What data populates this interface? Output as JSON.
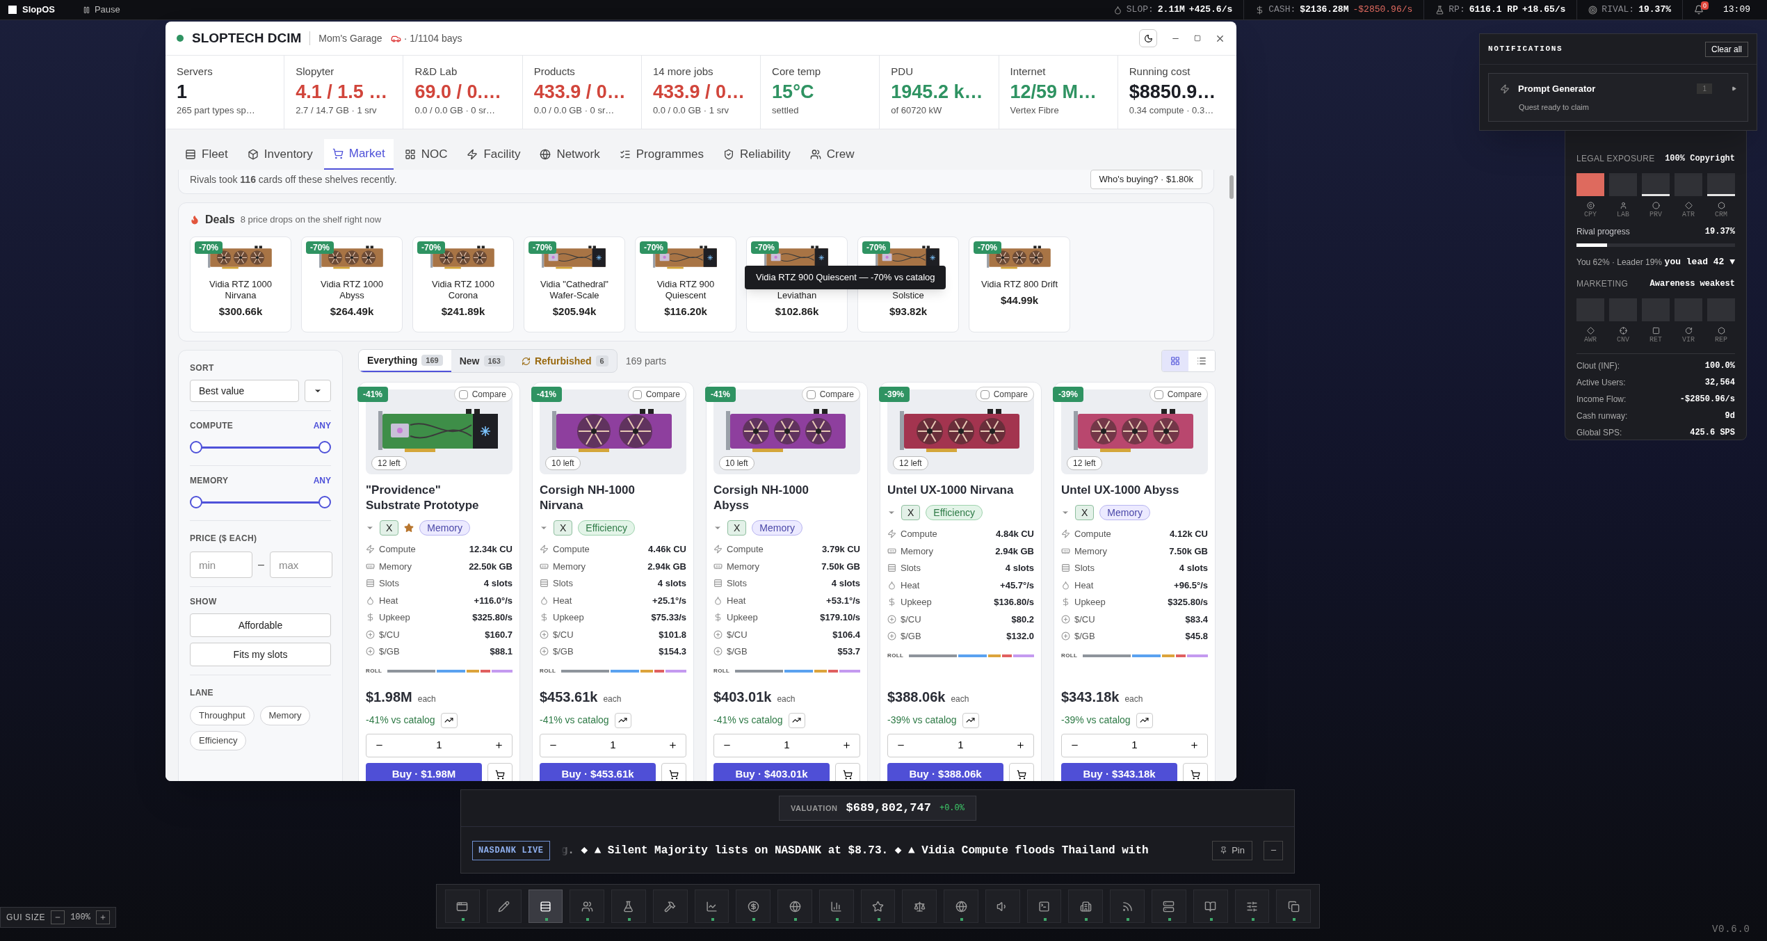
{
  "top_bar": {
    "brand": "SlopOS",
    "pause": "Pause",
    "stats": [
      {
        "label": "SLOP:",
        "value": "2.11M",
        "delta": "+425.6/s",
        "kind": "up"
      },
      {
        "label": "CASH:",
        "value": "$2136.28M",
        "delta": "-$2850.96/s",
        "kind": "down"
      },
      {
        "label": "RP:",
        "value": "6116.1 RP",
        "delta": "+18.65/s",
        "kind": "up"
      },
      {
        "label": "RIVAL:",
        "value": "19.37%"
      }
    ],
    "badge": "0",
    "time": "13:09"
  },
  "window": {
    "title": "SLOPTECH DCIM",
    "location": "Mom's Garage",
    "bays": "· 1/1104 bays",
    "stats": [
      {
        "label": "Servers",
        "value": "1",
        "sub": "265 part types sp…",
        "kind": "plain"
      },
      {
        "label": "Slopyter",
        "value": "4.1 / 1.5 …",
        "sub": "2.7 / 14.7 GB · 1 srv",
        "kind": "bad"
      },
      {
        "label": "R&D Lab",
        "value": "69.0 / 0.…",
        "sub": "0.0 / 0.0 GB · 0 sr…",
        "kind": "bad"
      },
      {
        "label": "Products",
        "value": "433.9 / 0…",
        "sub": "0.0 / 0.0 GB · 0 sr…",
        "kind": "bad"
      },
      {
        "label": "14 more jobs",
        "value": "433.9 / 0…",
        "sub": "0.0 / 0.0 GB · 1 srv",
        "kind": "bad"
      },
      {
        "label": "Core temp",
        "value": "15°C",
        "sub": "settled",
        "kind": "good"
      },
      {
        "label": "PDU",
        "value": "1945.2 k…",
        "sub": "of 60720 kW",
        "kind": "good"
      },
      {
        "label": "Internet",
        "value": "12/59 M…",
        "sub": "Vertex Fibre",
        "kind": "good"
      },
      {
        "label": "Running cost",
        "value": "$8850.9…",
        "sub": "0.34 compute · 0.3…",
        "kind": "plain"
      }
    ],
    "tabs": [
      {
        "label": "Fleet",
        "selected": false
      },
      {
        "label": "Inventory",
        "selected": false
      },
      {
        "label": "Market",
        "selected": true
      },
      {
        "label": "NOC",
        "selected": false
      },
      {
        "label": "Facility",
        "selected": false
      },
      {
        "label": "Network",
        "selected": false
      },
      {
        "label": "Programmes",
        "selected": false
      },
      {
        "label": "Reliability",
        "selected": false
      },
      {
        "label": "Crew",
        "selected": false
      }
    ]
  },
  "market": {
    "rivals_note": "Rivals took **116** cards off these shelves recently.",
    "whos_buying": "Who's buying? · $1.80k",
    "deals": {
      "title": "Deals",
      "subtitle": "8 price drops on the shelf right now",
      "tooltip": "Vidia RTZ 900 Quiescent — -70% vs catalog",
      "items": [
        {
          "badge": "-70%",
          "name": "Vidia RTZ 1000\nNirvana",
          "price": "$300.66k",
          "kind": "fans"
        },
        {
          "badge": "-70%",
          "name": "Vidia RTZ 1000\nAbyss",
          "price": "$264.49k",
          "kind": "fans"
        },
        {
          "badge": "-70%",
          "name": "Vidia RTZ 1000\nCorona",
          "price": "$241.89k",
          "kind": "fans"
        },
        {
          "badge": "-70%",
          "name": "Vidia \"Cathedral\"\nWafer-Scale",
          "price": "$205.94k",
          "kind": "blower"
        },
        {
          "badge": "-70%",
          "name": "Vidia RTZ 900\nQuiescent",
          "price": "$116.20k",
          "kind": "blower"
        },
        {
          "badge": "-70%",
          "name": "\nLeviathan",
          "price": "$102.86k",
          "kind": "blower"
        },
        {
          "badge": "-70%",
          "name": "\nSolstice",
          "price": "$93.82k",
          "kind": "blower"
        },
        {
          "badge": "-70%",
          "name": "Vidia RTZ 800 Drift",
          "price": "$44.99k",
          "kind": "fans"
        }
      ]
    },
    "filters": {
      "sort_label": "SORT",
      "sort_value": "Best value",
      "ranges": [
        {
          "label": "COMPUTE",
          "reading": "ANY",
          "level": 1
        },
        {
          "label": "MEMORY",
          "reading": "ANY",
          "level": 1
        }
      ],
      "price_label": "PRICE ($ EACH)",
      "min_placeholder": "min",
      "separator": "–",
      "max_placeholder": "max",
      "show_label": "SHOW",
      "show_buttons": [
        "Affordable",
        "Fits my slots"
      ],
      "lane_label": "LANE",
      "lanes": [
        "Throughput",
        "Memory",
        "Efficiency"
      ]
    },
    "segments": [
      {
        "label": "Everything",
        "count": "169",
        "kind": "all",
        "selected": true
      },
      {
        "label": "New",
        "count": "163",
        "kind": "new",
        "selected": false
      },
      {
        "label": "Refurbished",
        "count": "6",
        "kind": "refurbished",
        "selected": false
      }
    ],
    "parts_count": "169 parts",
    "views": [
      {
        "kind": "grid",
        "selected": true
      },
      {
        "kind": "list",
        "selected": false
      }
    ],
    "products": [
      {
        "discount": "-41%",
        "compare": {
          "label": "Compare",
          "checked": false
        },
        "stock": "12 left",
        "kind": "blower",
        "name": "\"Providence\"\nSubstrate Prototype",
        "tags": [
          {
            "kind": "tier",
            "label": "X"
          },
          {
            "kind": "star"
          },
          {
            "kind": "memory",
            "label": "Memory"
          }
        ],
        "specs": [
          {
            "label": "Compute",
            "value": "12.34k CU"
          },
          {
            "label": "Memory",
            "value": "22.50k GB"
          },
          {
            "label": "Slots",
            "value": "4 slots"
          },
          {
            "label": "Heat",
            "value": "+116.0°/s"
          },
          {
            "label": "Upkeep",
            "value": "$325.80/s"
          },
          {
            "label": "$/CU",
            "value": "$160.7"
          },
          {
            "label": "$/GB",
            "value": "$88.1"
          }
        ],
        "roll": "ROLL",
        "price": "$1.98M",
        "unit": "each",
        "vs_catalog": "-41% vs catalog",
        "qty": "1",
        "buy": "Buy · $1.98M"
      },
      {
        "discount": "-41%",
        "compare": {
          "label": "Compare",
          "checked": false
        },
        "stock": "10 left",
        "kind": "two-fan",
        "name": "Corsigh NH-1000\nNirvana",
        "tags": [
          {
            "kind": "tier",
            "label": "X"
          },
          {
            "kind": "efficiency",
            "label": "Efficiency"
          }
        ],
        "specs": [
          {
            "label": "Compute",
            "value": "4.46k CU"
          },
          {
            "label": "Memory",
            "value": "2.94k GB"
          },
          {
            "label": "Slots",
            "value": "4 slots"
          },
          {
            "label": "Heat",
            "value": "+25.1°/s"
          },
          {
            "label": "Upkeep",
            "value": "$75.33/s"
          },
          {
            "label": "$/CU",
            "value": "$101.8"
          },
          {
            "label": "$/GB",
            "value": "$154.3"
          }
        ],
        "roll": "ROLL",
        "price": "$453.61k",
        "unit": "each",
        "vs_catalog": "-41% vs catalog",
        "qty": "1",
        "buy": "Buy · $453.61k"
      },
      {
        "discount": "-41%",
        "compare": {
          "label": "Compare",
          "checked": false
        },
        "stock": "10 left",
        "kind": "fans",
        "name": "Corsigh NH-1000\nAbyss",
        "tags": [
          {
            "kind": "tier",
            "label": "X"
          },
          {
            "kind": "memory",
            "label": "Memory"
          }
        ],
        "specs": [
          {
            "label": "Compute",
            "value": "3.79k CU"
          },
          {
            "label": "Memory",
            "value": "7.50k GB"
          },
          {
            "label": "Slots",
            "value": "4 slots"
          },
          {
            "label": "Heat",
            "value": "+53.1°/s"
          },
          {
            "label": "Upkeep",
            "value": "$179.10/s"
          },
          {
            "label": "$/CU",
            "value": "$106.4"
          },
          {
            "label": "$/GB",
            "value": "$53.7"
          }
        ],
        "roll": "ROLL",
        "price": "$403.01k",
        "unit": "each",
        "vs_catalog": "-41% vs catalog",
        "qty": "1",
        "buy": "Buy · $403.01k"
      },
      {
        "discount": "-39%",
        "compare": {
          "label": "Compare",
          "checked": false
        },
        "stock": "12 left",
        "kind": "fans",
        "name": "Untel UX-1000 Nirvana",
        "tags": [
          {
            "kind": "tier",
            "label": "X"
          },
          {
            "kind": "efficiency",
            "label": "Efficiency"
          }
        ],
        "specs": [
          {
            "label": "Compute",
            "value": "4.84k CU"
          },
          {
            "label": "Memory",
            "value": "2.94k GB"
          },
          {
            "label": "Slots",
            "value": "4 slots"
          },
          {
            "label": "Heat",
            "value": "+45.7°/s"
          },
          {
            "label": "Upkeep",
            "value": "$136.80/s"
          },
          {
            "label": "$/CU",
            "value": "$80.2"
          },
          {
            "label": "$/GB",
            "value": "$132.0"
          }
        ],
        "roll": "ROLL",
        "price": "$388.06k",
        "unit": "each",
        "vs_catalog": "-39% vs catalog",
        "qty": "1",
        "buy": "Buy · $388.06k"
      },
      {
        "discount": "-39%",
        "compare": {
          "label": "Compare",
          "checked": false
        },
        "stock": "12 left",
        "kind": "fans",
        "name": "Untel UX-1000 Abyss",
        "tags": [
          {
            "kind": "tier",
            "label": "X"
          },
          {
            "kind": "memory",
            "label": "Memory"
          }
        ],
        "specs": [
          {
            "label": "Compute",
            "value": "4.12k CU"
          },
          {
            "label": "Memory",
            "value": "7.50k GB"
          },
          {
            "label": "Slots",
            "value": "4 slots"
          },
          {
            "label": "Heat",
            "value": "+96.5°/s"
          },
          {
            "label": "Upkeep",
            "value": "$325.80/s"
          },
          {
            "label": "$/CU",
            "value": "$83.4"
          },
          {
            "label": "$/GB",
            "value": "$45.8"
          }
        ],
        "roll": "ROLL",
        "price": "$343.18k",
        "unit": "each",
        "vs_catalog": "-39% vs catalog",
        "qty": "1",
        "buy": "Buy · $343.18k"
      }
    ]
  },
  "notifications": {
    "title": "NOTIFICATIONS",
    "clear": "Clear all",
    "items": [
      {
        "title": "Prompt Generator",
        "count": "1",
        "body": "Quest ready to claim"
      }
    ]
  },
  "status_panel": {
    "legal_label": "LEGAL EXPOSURE",
    "legal_value": "100% Copyright",
    "legal": [
      {
        "code": "CPY",
        "kind": "full"
      },
      {
        "code": "LAB",
        "kind": "none"
      },
      {
        "code": "PRV",
        "kind": "trace"
      },
      {
        "code": "ATR",
        "kind": "none"
      },
      {
        "code": "CRM",
        "kind": "trace"
      }
    ],
    "rival": {
      "label": "Rival progress",
      "value": "19.37%",
      "level": 0.1937
    },
    "standing": "You 62% · Leader 19%",
    "lead": "you lead 42 ▼",
    "marketing_label": "MARKETING",
    "marketing_value": "Awareness weakest",
    "marketing": [
      {
        "code": "AWR"
      },
      {
        "code": "CNV"
      },
      {
        "code": "RET"
      },
      {
        "code": "VIR"
      },
      {
        "code": "REP"
      }
    ],
    "rows": [
      {
        "label": "Clout (INF):",
        "value": "100.0%"
      },
      {
        "label": "Active Users:",
        "value": "32,564"
      },
      {
        "label": "Income Flow:",
        "value": "-$2850.96/s"
      },
      {
        "label": "Cash runway:",
        "value": "9d"
      },
      {
        "label": "Global SPS:",
        "value": "425.6 SPS"
      }
    ]
  },
  "valuation": {
    "label": "VALUATION",
    "value": "$689,802,747",
    "change": "+0.0%"
  },
  "ticker": {
    "badge": "NASDANK LIVE",
    "text": "g. ◆ ▲ Silent Majority lists on NASDANK at $8.73. ◆ ▲ Vidia Compute floods Thailand with",
    "pin": "Pin"
  },
  "dock": [
    {
      "selected": false,
      "on": true
    },
    {
      "selected": false,
      "on": false
    },
    {
      "selected": true,
      "on": true
    },
    {
      "selected": false,
      "on": true
    },
    {
      "selected": false,
      "on": true
    },
    {
      "selected": false,
      "on": false
    },
    {
      "selected": false,
      "on": true
    },
    {
      "selected": false,
      "on": true
    },
    {
      "selected": false,
      "on": true
    },
    {
      "selected": false,
      "on": true
    },
    {
      "selected": false,
      "on": true
    },
    {
      "selected": false,
      "on": false
    },
    {
      "selected": false,
      "on": true
    },
    {
      "selected": false,
      "on": false
    },
    {
      "selected": false,
      "on": true
    },
    {
      "selected": false,
      "on": true
    },
    {
      "selected": false,
      "on": true
    },
    {
      "selected": false,
      "on": true
    },
    {
      "selected": false,
      "on": true
    },
    {
      "selected": false,
      "on": true
    },
    {
      "selected": false,
      "on": true
    }
  ],
  "gui_size": {
    "label": "GUI SIZE",
    "value": "100%"
  },
  "version": "V0.6.0"
}
